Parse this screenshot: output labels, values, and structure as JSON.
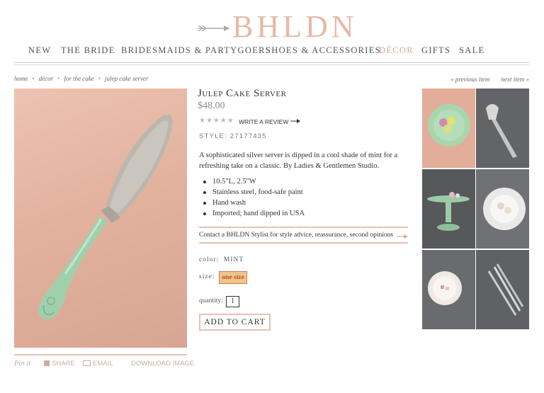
{
  "brand": {
    "logo_text": "BHLDN"
  },
  "nav": [
    "NEW",
    "THE BRIDE",
    "BRIDESMAIDS & PARTYGOERS",
    "SHOES & ACCESSORIES",
    "DÉCOR",
    "GIFTS",
    "SALE"
  ],
  "breadcrumb": [
    "home",
    "décor",
    "for the cake",
    "julep cake server"
  ],
  "pager": {
    "previous": "« previous item",
    "next": "next item »"
  },
  "product": {
    "title": "Julep Cake Server",
    "price": "$48.00",
    "stars": "★★★★★",
    "review_label": "WRITE A REVIEW",
    "style": "STYLE: 27177435",
    "description": "A sophisticated silver server is dipped in a cool shade of mint for a refreshing take on a classic. By Ladies & Gentlemen Studio.",
    "features": [
      "10.5\"L, 2.5\"W",
      "Stainless steel, food-safe paint",
      "Hand wash",
      "Imported; hand dipped in USA"
    ],
    "contact": "Contact a BHLDN Stylist for style advice, reassurance, second opinions",
    "color_label": "color:",
    "color_value": "MINT",
    "size_label": "size:",
    "size_value": "one size",
    "quantity_label": "quantity:",
    "quantity_value": "1",
    "add_to_cart": "ADD TO CART"
  },
  "share": {
    "pin": "Pin it",
    "share": "SHARE",
    "email": "EMAIL",
    "download": "DOWNLOAD IMAGE"
  },
  "colors": {
    "accent": "#e7b9a6",
    "active_nav": "#d9a796",
    "size_bg": "#f0c58a",
    "mint": "#9fd0ab"
  }
}
